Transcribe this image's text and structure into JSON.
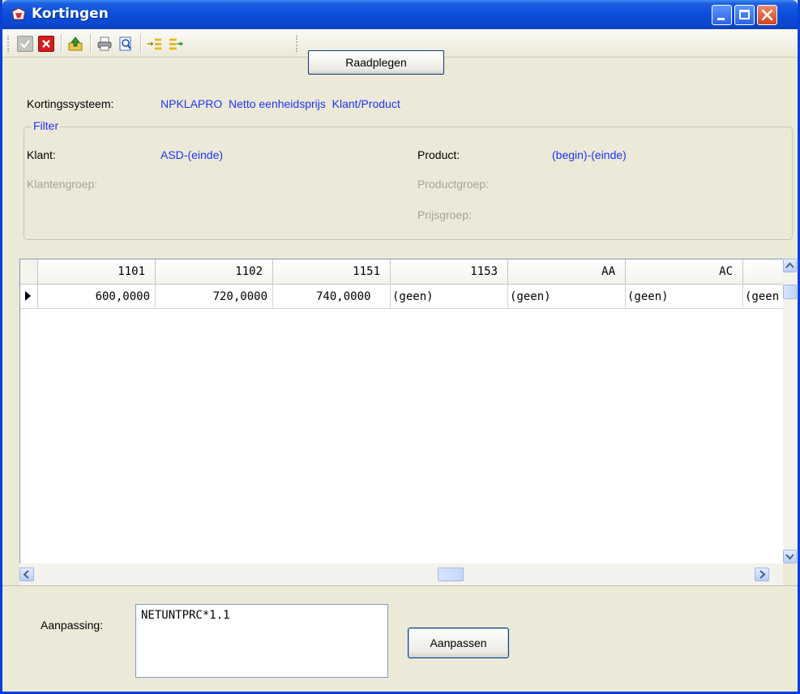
{
  "window": {
    "title": "Kortingen"
  },
  "toolbar": {
    "raadplegen_label": "Raadplegen"
  },
  "header": {
    "system_label": "Kortingssysteem:",
    "system_value": "NPKLAPRO  Netto eenheidsprijs  Klant/Product"
  },
  "filter": {
    "legend": "Filter",
    "klant_label": "Klant:",
    "klant_value": "ASD-(einde)",
    "klantengroep_label": "Klantengroep:",
    "product_label": "Product:",
    "product_value": "(begin)-(einde)",
    "productgroep_label": "Productgroep:",
    "prijsgroep_label": "Prijsgroep:"
  },
  "grid": {
    "columns": [
      "1101",
      "1102",
      "1151",
      "1153",
      "AA",
      "AC"
    ],
    "rows": [
      [
        "600,0000",
        "720,0000",
        "740,0000",
        "(geen)",
        "(geen)",
        "(geen)",
        "(geen"
      ]
    ]
  },
  "footer": {
    "aanpassing_label": "Aanpassing:",
    "formula": "NETUNTPRC*1.1",
    "aanpassen_label": "Aanpassen"
  },
  "icons": {
    "app": "kortingen-app-icon",
    "ok": "check-icon",
    "cancel": "cancel-icon",
    "export": "export-icon",
    "print": "printer-icon",
    "preview": "print-preview-icon",
    "expand": "expand-icon",
    "collapse": "collapse-icon"
  },
  "colors": {
    "title_bar": "#0b4fdc",
    "link_blue": "#1e32ff",
    "disabled_gray": "#a6a39a",
    "close_red": "#d2431c"
  }
}
